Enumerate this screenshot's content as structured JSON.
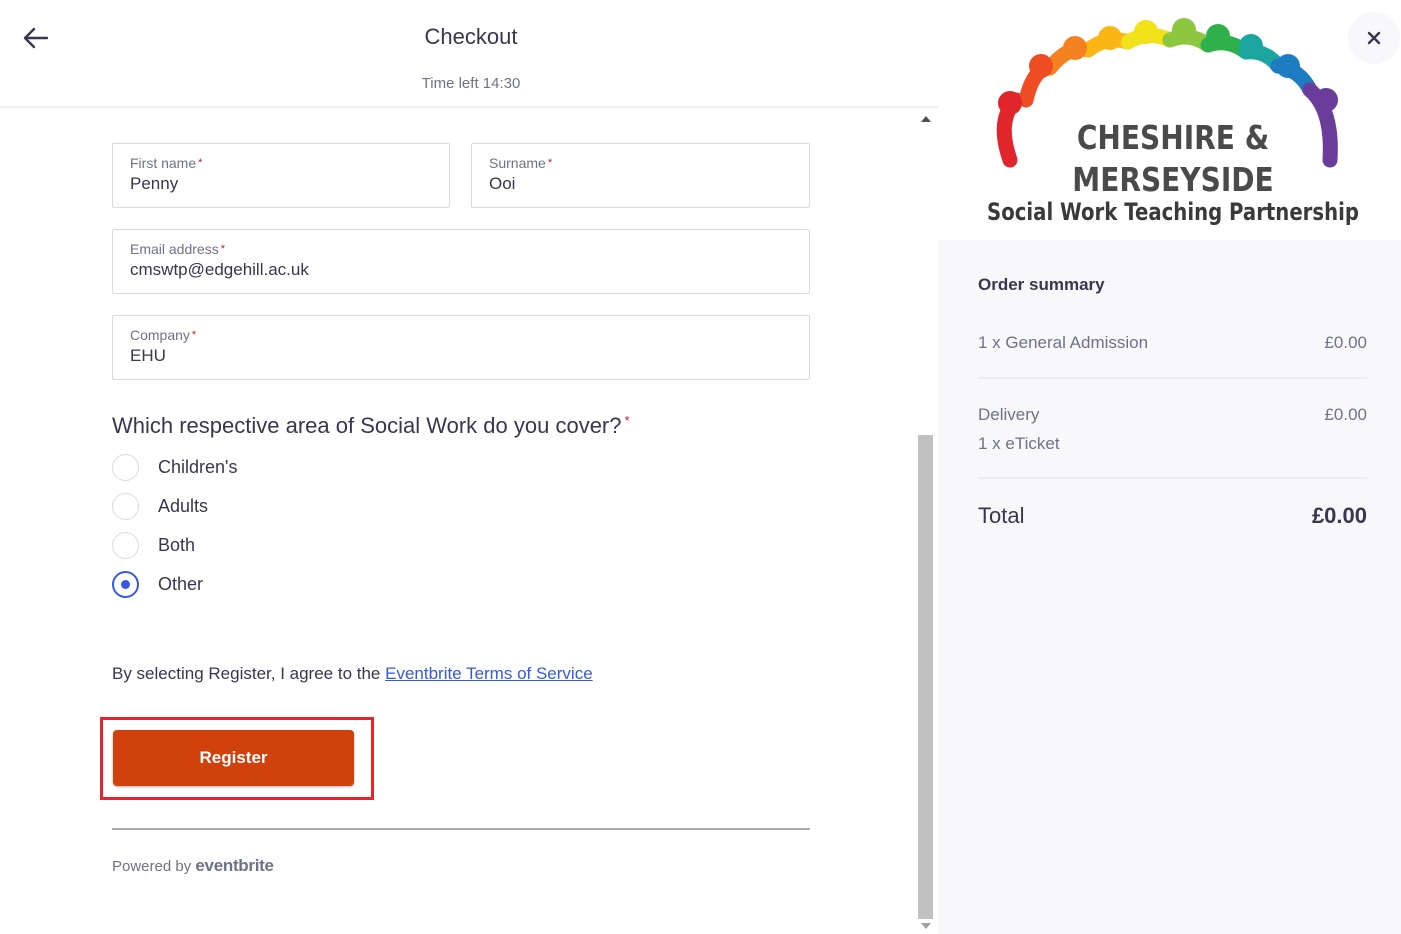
{
  "header": {
    "title": "Checkout",
    "timer": "Time left 14:30",
    "back_icon": "arrow-left-icon"
  },
  "form": {
    "first_name": {
      "label": "First name",
      "required": "*",
      "value": "Penny"
    },
    "surname": {
      "label": "Surname",
      "required": "*",
      "value": "Ooi"
    },
    "email": {
      "label": "Email address",
      "required": "*",
      "value": "cmswtp@edgehill.ac.uk"
    },
    "company": {
      "label": "Company",
      "required": "*",
      "value": "EHU"
    },
    "question": {
      "text": "Which respective area of Social Work do you cover?",
      "required": "*"
    },
    "options": [
      {
        "label": "Children's",
        "checked": false
      },
      {
        "label": "Adults",
        "checked": false
      },
      {
        "label": "Both",
        "checked": false
      },
      {
        "label": "Other",
        "checked": true
      }
    ]
  },
  "terms": {
    "prefix": "By selecting Register, I agree to the",
    "link": "Eventbrite Terms of Service"
  },
  "register_label": "Register",
  "powered": {
    "prefix": "Powered by",
    "brand": "eventbrite"
  },
  "sidebar": {
    "logo": {
      "line1": "CHESHIRE &",
      "line2": "MERSEYSIDE",
      "line3": "Social Work Teaching Partnership"
    },
    "close_icon": "close-icon",
    "order_summary": {
      "title": "Order summary",
      "items": [
        {
          "label": "1 x General Admission",
          "amount": "£0.00"
        }
      ],
      "delivery": {
        "label": "Delivery",
        "amount": "£0.00",
        "sub": "1 x eTicket"
      },
      "total": {
        "label": "Total",
        "amount": "£0.00"
      }
    }
  },
  "colors": {
    "accent": "#3659e3",
    "register": "#d1410c",
    "highlight": "#e8242a"
  }
}
